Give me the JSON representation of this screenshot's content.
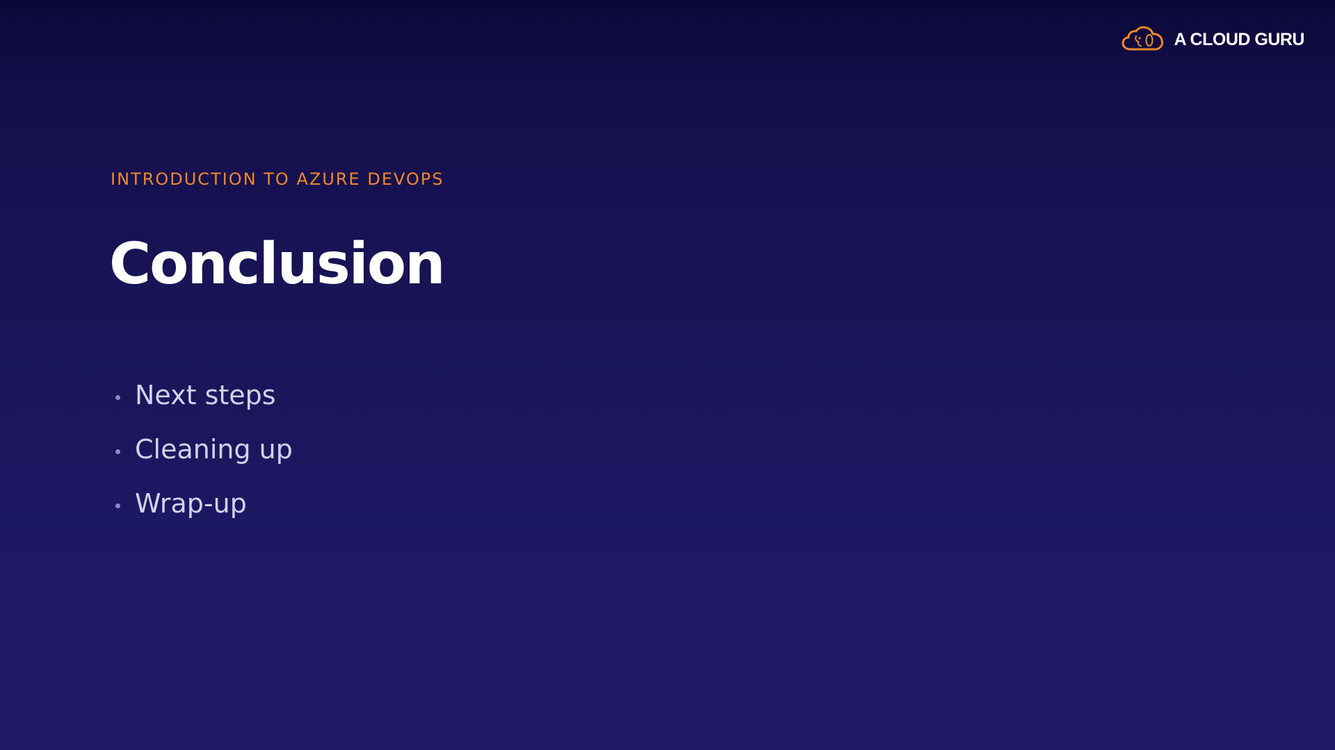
{
  "brand": {
    "name": "A CLOUD GURU",
    "icon": "cloud-logo-icon",
    "accent_color": "#f3882a"
  },
  "slide": {
    "course_label": "INTRODUCTION TO AZURE DEVOPS",
    "title": "Conclusion",
    "bullets": [
      {
        "text": "Next steps"
      },
      {
        "text": "Cleaning up"
      },
      {
        "text": "Wrap-up"
      }
    ]
  },
  "colors": {
    "background_top": "#0b0838",
    "background_bottom": "#1e1866",
    "title": "#ffffff",
    "bullet_text": "#d4d1ee"
  }
}
